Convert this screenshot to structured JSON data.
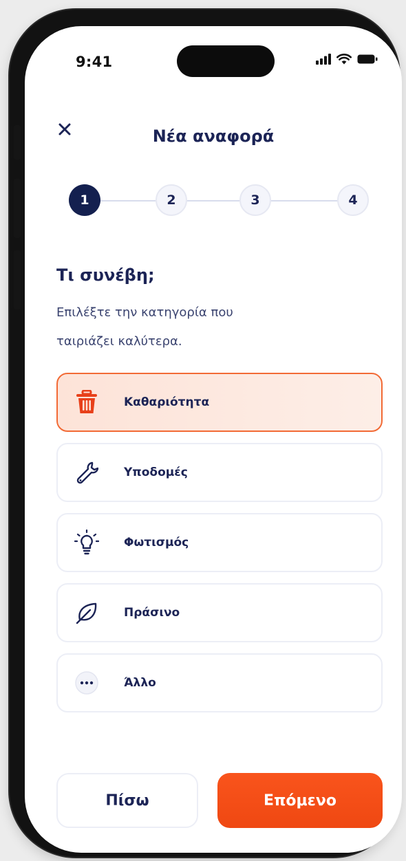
{
  "status_bar": {
    "time": "9:41",
    "signal_icon": "signal-icon",
    "wifi_icon": "wifi-icon",
    "battery_icon": "battery-icon"
  },
  "header": {
    "close_icon": "close-icon",
    "title": "Νέα αναφορά"
  },
  "stepper": {
    "current_step": 1,
    "steps": [
      "1",
      "2",
      "3",
      "4"
    ]
  },
  "question": {
    "title": "Τι συνέβη;",
    "subtitle_line1": "Επιλέξτε την κατηγορία που",
    "subtitle_line2": "ταιριάζει καλύτερα."
  },
  "options": [
    {
      "label": "Καθαριότητα",
      "icon": "trash-icon",
      "selected": true
    },
    {
      "label": "Υποδομές",
      "icon": "wrench-icon",
      "selected": false
    },
    {
      "label": "Φωτισμός",
      "icon": "lightbulb-icon",
      "selected": false
    },
    {
      "label": "Πράσινο",
      "icon": "leaf-icon",
      "selected": false
    },
    {
      "label": "Άλλο",
      "icon": "more-icon",
      "selected": false
    }
  ],
  "footer": {
    "back_label": "Πίσω",
    "next_label": "Επόμενο"
  },
  "colors": {
    "accent": "#F9541C",
    "navy": "#14204F",
    "selected_bg": "#FDE3D8"
  }
}
